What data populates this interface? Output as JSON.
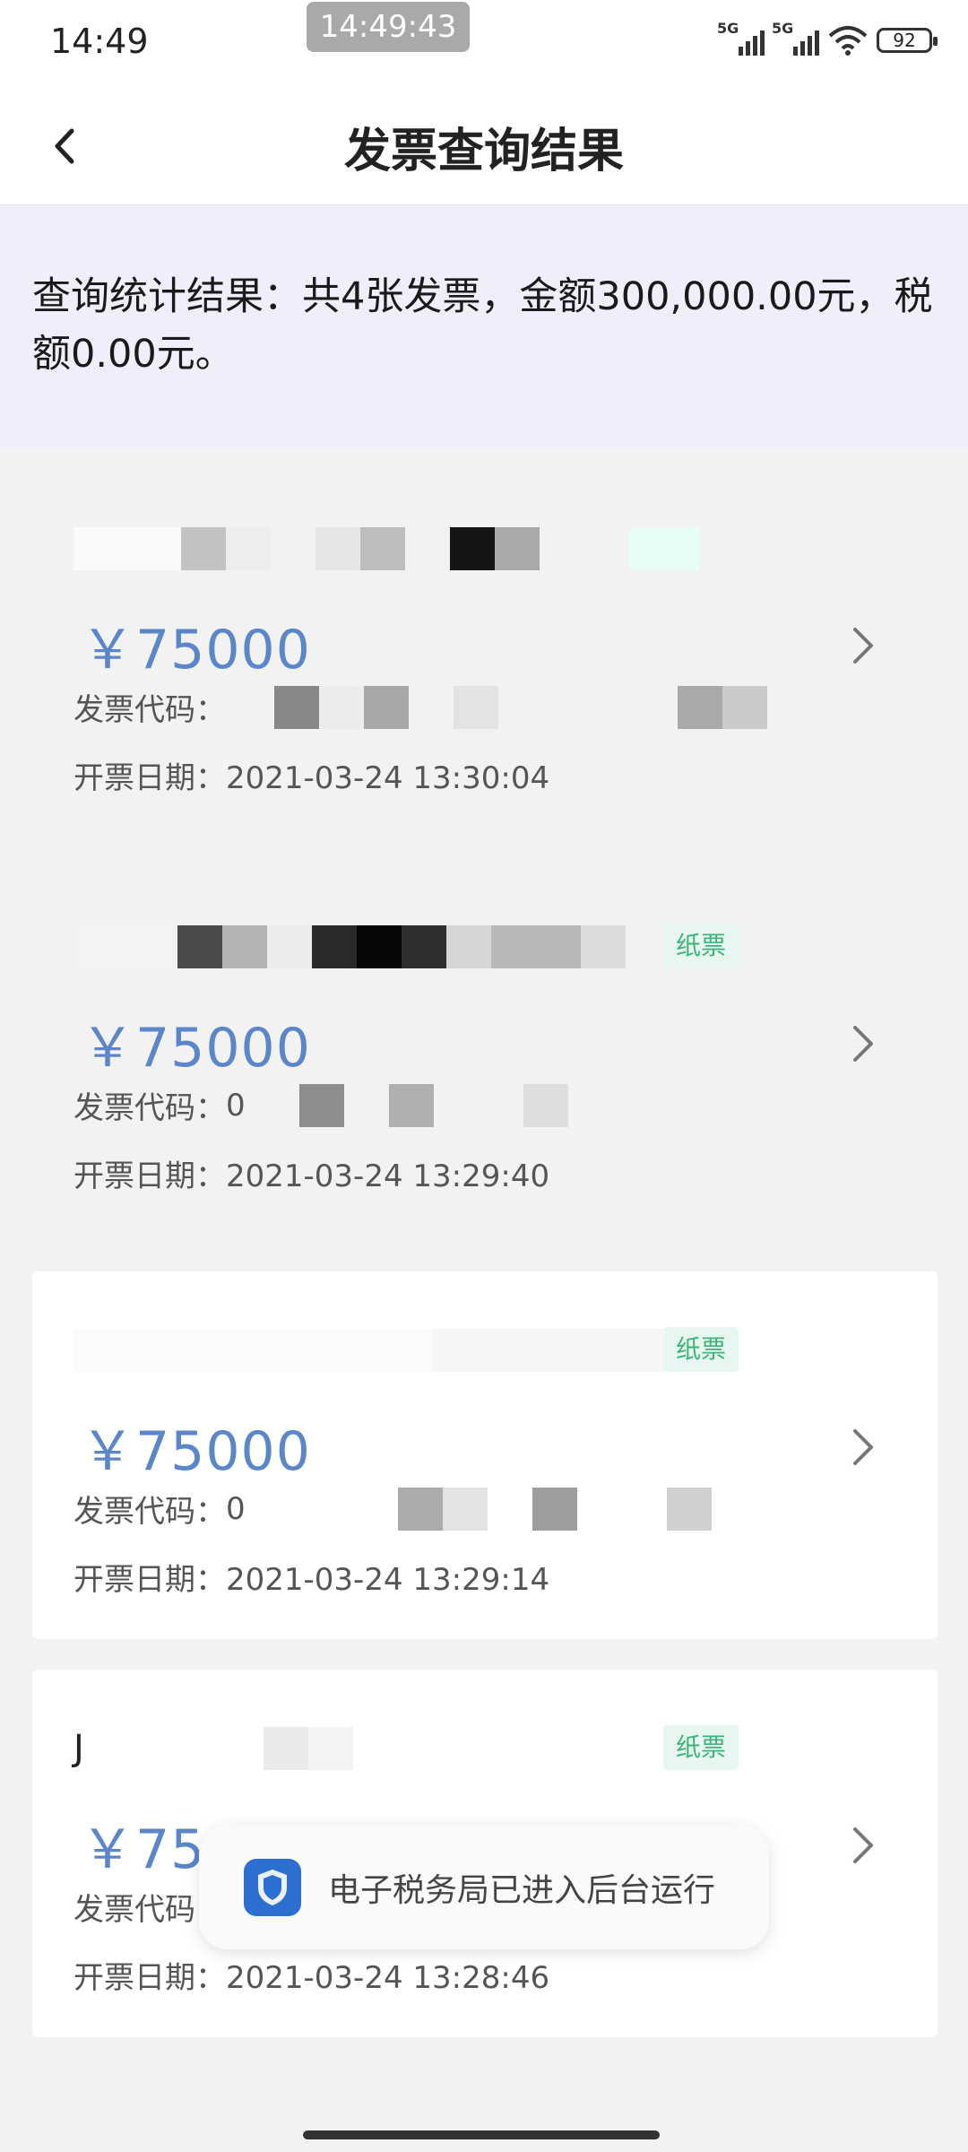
{
  "status_bar": {
    "time": "14:49",
    "center_time": "14:49:43",
    "network_1": "5G",
    "network_2": "5G",
    "battery": "92",
    "icons": [
      "signal-icon",
      "signal-icon",
      "wifi-icon",
      "battery-icon"
    ]
  },
  "header": {
    "title": "发票查询结果",
    "back_icon": "chevron-left-icon"
  },
  "summary": {
    "text": "查询统计结果：共4张发票，金额300,000.00元，税额0.00元。"
  },
  "invoices": [
    {
      "amount": "￥75000",
      "code_label": "发票代码：",
      "code_value": "",
      "date_label": "开票日期：",
      "date_value": "2021-03-24 13:30:04",
      "tag": ""
    },
    {
      "amount": "￥75000",
      "code_label": "发票代码：",
      "code_value": "0",
      "date_label": "开票日期：",
      "date_value": "2021-03-24 13:29:40",
      "tag": "纸票"
    },
    {
      "amount": "￥75000",
      "code_label": "发票代码：",
      "code_value": "0",
      "date_label": "开票日期：",
      "date_value": "2021-03-24 13:29:14",
      "tag": "纸票"
    },
    {
      "amount": "￥75000",
      "code_label": "发票代码",
      "code_value": "",
      "date_label": "开票日期：",
      "date_value": "2021-03-24 13:28:46",
      "tag": "纸票",
      "company_initial": "J"
    }
  ],
  "toast": {
    "text": "电子税务局已进入后台运行",
    "icon": "tax-bureau-app-icon"
  },
  "colors": {
    "amount": "#5b86c9",
    "summary_bg": "#efeffc",
    "paper_tag_text": "#3fb37a",
    "paper_tag_bg": "#e7f7ef"
  }
}
